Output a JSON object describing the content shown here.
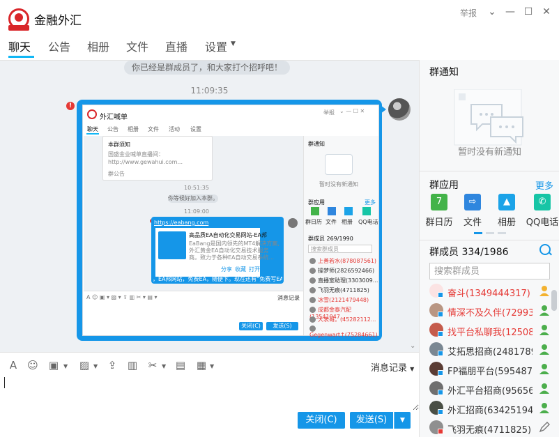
{
  "window": {
    "title": "金融外汇",
    "report": "举报",
    "controls": [
      "chevron-down",
      "minimize",
      "maximize",
      "close"
    ]
  },
  "tabs": [
    {
      "label": "聊天",
      "active": true
    },
    {
      "label": "公告"
    },
    {
      "label": "相册"
    },
    {
      "label": "文件"
    },
    {
      "label": "直播"
    },
    {
      "label": "设置"
    }
  ],
  "chat": {
    "system_notice": "你已经是群成员了，和大家打个招呼吧！",
    "timestamp": "11:09:35",
    "screenshot": {
      "title": "外汇喊单",
      "report": "举报",
      "tabs": [
        "聊天",
        "公告",
        "相册",
        "文件",
        "活动",
        "设置"
      ],
      "notice_title": "本群须知",
      "notice_line1": "国盛金业喊单直播间：",
      "notice_line2": "http://www.gewahui.com...",
      "notice_footer": "群公告",
      "time1": "10:51:35",
      "join_notice": "你等候好加入本群。",
      "time2": "11:09:00",
      "link_url": "https://eabang.com",
      "link_title": "高品质EA自动化交易网站-EA邦",
      "link_desc1": "EaBang是国内领先的MT4解决方案,",
      "link_desc2": "外汇黄金EA自动化交易技术服务",
      "link_desc3": "商。致力于各种EA自动交易系统...",
      "link_actions": [
        "分享",
        "收藏",
        "打开"
      ],
      "promo": "，EA邦网站，免费EA，随便下。现在还有“免费写EA”活动",
      "history": "消息记录",
      "close_btn": "关闭(C)",
      "send_btn": "发送(S)",
      "side_notice_title": "群通知",
      "side_notice_empty": "暂时没有新通知",
      "side_apps_title": "群应用",
      "side_apps_more": "更多",
      "side_apps": [
        "群日历",
        "文件",
        "相册",
        "QQ电话"
      ],
      "side_members_title": "群成员 269/1990",
      "side_members_search": "搜索群成员",
      "side_members": [
        {
          "name": "上善若水(878087561)",
          "color": "#e53935"
        },
        {
          "name": "操梦师(2826592466)",
          "color": "#333333"
        },
        {
          "name": "直播室助理(3303009...",
          "color": "#333333"
        },
        {
          "name": "飞羽无痕(4711825)",
          "color": "#333333"
        },
        {
          "name": "冰雪(2121479448)",
          "color": "#e53935"
        },
        {
          "name": "成都金泰汽配(13541047...",
          "color": "#e53935"
        },
        {
          "name": "大表哥。(45282112...",
          "color": "#e53935"
        },
        {
          "name": "Gegenwart↑(75284661)",
          "color": "#e53935"
        }
      ]
    }
  },
  "composer": {
    "history": "消息记录",
    "close_label": "关闭(C)",
    "send_label": "发送(S)"
  },
  "sidebar": {
    "notice_title": "群通知",
    "notice_empty": "暂时没有新通知",
    "apps_title": "群应用",
    "apps_more": "更多",
    "apps": [
      {
        "label": "群日历",
        "icon": "calendar-icon",
        "color": "#43b349"
      },
      {
        "label": "文件",
        "icon": "file-icon",
        "color": "#2f86de"
      },
      {
        "label": "相册",
        "icon": "album-icon",
        "color": "#1ba3e8"
      },
      {
        "label": "QQ电话",
        "icon": "phone-icon",
        "color": "#17c5a6"
      }
    ],
    "members_title": "群成员 334/1986",
    "members_search_placeholder": "搜索群成员",
    "members": [
      {
        "name": "奋斗(1349444317)",
        "color": "#e53935",
        "role": "owner"
      },
      {
        "name": "情深不及久伴(72993652",
        "color": "#e53935",
        "role": "admin"
      },
      {
        "name": "找平台私聊我(12508990",
        "color": "#e53935",
        "role": "admin"
      },
      {
        "name": "艾拓思招商(24817895522",
        "color": "#333333",
        "role": "admin"
      },
      {
        "name": "FP福朋平台(595487914)",
        "color": "#333333",
        "role": "admin"
      },
      {
        "name": "外汇平台招商(95656574",
        "color": "#333333",
        "role": "admin"
      },
      {
        "name": "外汇招商(634251940)",
        "color": "#333333",
        "role": "admin"
      },
      {
        "name": "飞羽无痕(4711825)",
        "color": "#333333",
        "role": "edit"
      }
    ]
  }
}
